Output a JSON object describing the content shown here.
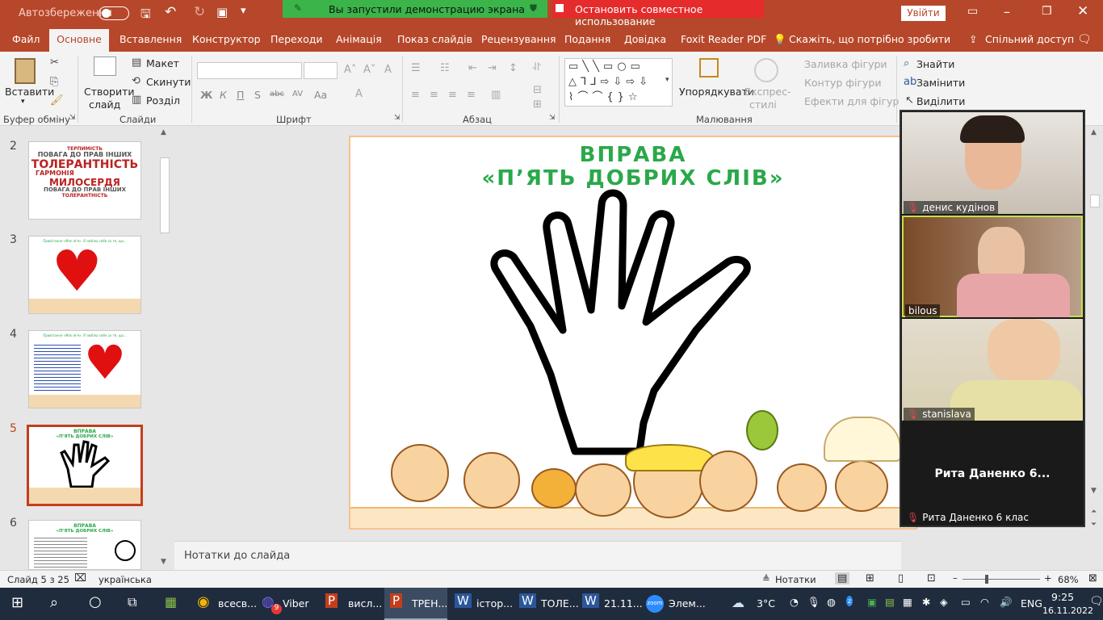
{
  "title_bar": {
    "autosave_label": "Автозбереження",
    "signin": "Увійти"
  },
  "share_banner": {
    "message": "Вы запустили демонстрацию экрана",
    "stop": "Остановить совместное использование"
  },
  "tabs": [
    "Файл",
    "Основне",
    "Вставлення",
    "Конструктор",
    "Переходи",
    "Анімація",
    "Показ слайдів",
    "Рецензування",
    "Подання",
    "Довідка",
    "Foxit Reader PDF"
  ],
  "active_tab": "Основне",
  "tell_me": "Скажіть, що потрібно зробити",
  "share_btn": "Спільний доступ",
  "ribbon": {
    "clipboard": {
      "label": "Буфер обміну",
      "paste": "Вставити"
    },
    "slides": {
      "label": "Слайди",
      "new_slide": "Створити",
      "new_slide2": "слайд",
      "layout": "Макет",
      "reset": "Скинути",
      "section": "Розділ"
    },
    "font": {
      "label": "Шрифт",
      "bold": "Ж",
      "italic": "К",
      "underline": "П",
      "shadow": "S",
      "strike": "abc",
      "spacing": "AV",
      "case": "Aa"
    },
    "paragraph": {
      "label": "Абзац"
    },
    "drawing": {
      "label": "Малювання",
      "arrange": "Упорядкувати",
      "quick_styles": "Експрес-",
      "quick_styles2": "стилі",
      "fill": "Заливка фігури",
      "outline": "Контур фігури",
      "effects": "Ефекти для фігур"
    },
    "editing": {
      "find": "Знайти",
      "replace": "Замінити",
      "select": "Виділити"
    }
  },
  "thumbnails": [
    {
      "num": "2",
      "words": [
        "ТЕРПИМІСТЬ",
        "ПОВАГА ДО ПРАВ ІНШИХ",
        "ТОЛЕРАНТНІСТЬ",
        "ГАРМОНІЯ",
        "МИЛОСЕРДЯ",
        "ПОВАГА ДО ПРАВ ІНШИХ",
        "ТОЛЕРАНТНІСТЬ"
      ]
    },
    {
      "num": "3",
      "caption": "Привітання «Моє ім'я». Я люблю себе за те, що..."
    },
    {
      "num": "4",
      "caption": "Привітання «Моє ім'я». Я люблю себе за те, що..."
    },
    {
      "num": "5",
      "line1": "ВПРАВА",
      "line2": "«П'ЯТЬ ДОБРИХ СЛІВ»"
    },
    {
      "num": "6",
      "line1": "ВПРАВА",
      "line2": "«П'ЯТЬ ДОБРИХ СЛІВ»"
    }
  ],
  "slide": {
    "title1": "ВПРАВА",
    "title2": "«П’ЯТЬ ДОБРИХ СЛІВ»"
  },
  "notes_placeholder": "Нотатки до слайда",
  "status": {
    "slide_of": "Слайд 5 з 25",
    "language": "українська",
    "notes": "Нотатки",
    "zoom": "68%"
  },
  "participants": [
    "денис кудінов",
    "bilous",
    "stanislava",
    "Рита Даненко 6..."
  ],
  "participant4_full": "Рита Даненко 6 клас",
  "taskbar": {
    "items": [
      "всесв...",
      "Viber",
      "висл...",
      "ТРЕН...",
      "істор...",
      "ТОЛЕ...",
      "21.11...",
      "Элем..."
    ],
    "viber_badge": "9",
    "temp": "3°C",
    "lang": "ENG",
    "time": "9:25",
    "date": "16.11.2022"
  },
  "colors": {
    "accent": "#b7472a",
    "title_green": "#2aa84a",
    "share_green": "#3bb54a",
    "stop_red": "#e52b2b"
  }
}
